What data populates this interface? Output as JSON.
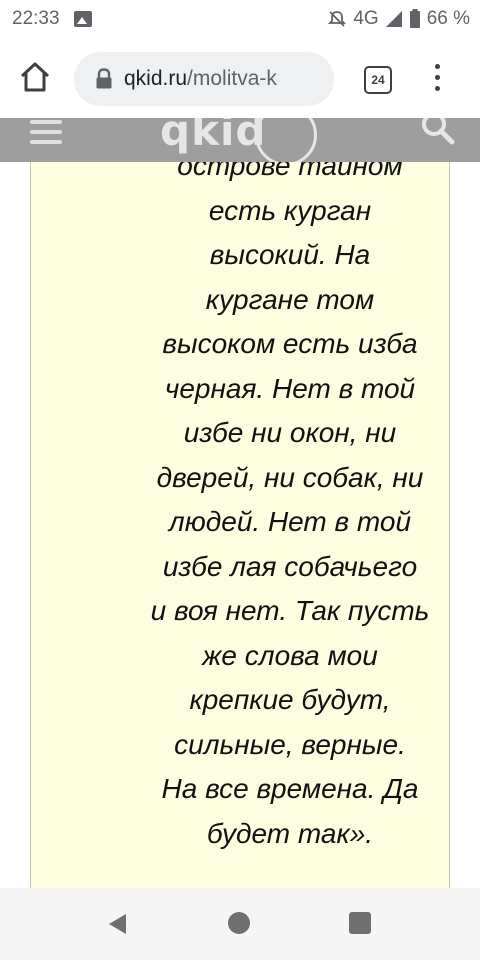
{
  "status_bar": {
    "time": "22:33",
    "network": "4G",
    "battery": "66 %",
    "icons": [
      "gallery-icon",
      "mute-icon",
      "signal-icon",
      "battery-icon"
    ]
  },
  "browser": {
    "url_host": "qkid.ru",
    "url_path": "/molitva-k",
    "tab_count": "24",
    "icons": [
      "home-icon",
      "lock-icon",
      "tabs-icon",
      "more-vert-icon"
    ]
  },
  "site_header": {
    "logo_text": "qkid",
    "icons": [
      "hamburger-menu-icon",
      "search-icon"
    ],
    "background": "#9e9e9e"
  },
  "article": {
    "background": "#fdfde0",
    "lines": [
      "острове тайном",
      "есть курган",
      "высокий. На",
      "кургане том",
      "высоком есть изба",
      "черная. Нет в той",
      "избе ни окон, ни",
      "дверей, ни собак, ни",
      "людей. Нет в той",
      "избе лая собачьего",
      "и воя нет. Так пусть",
      "же слова мои",
      "крепкие будут,",
      "сильные, верные.",
      "На все времена. Да",
      "будет так»."
    ]
  },
  "nav_bar": {
    "icons": [
      "back-icon",
      "home-circle-icon",
      "recents-icon"
    ]
  }
}
